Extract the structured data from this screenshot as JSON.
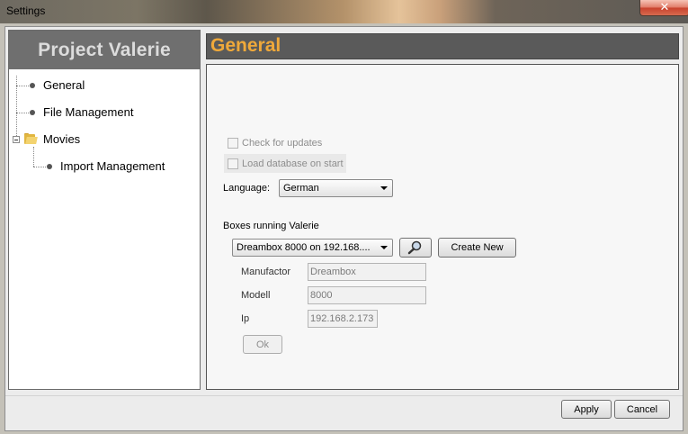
{
  "window": {
    "title": "Settings",
    "close_label": "✕"
  },
  "sidebar": {
    "header": "Project Valerie",
    "items": [
      {
        "label": "General"
      },
      {
        "label": "File Management"
      },
      {
        "label": "Movies",
        "icon": "folder-icon"
      },
      {
        "label": "Import Management"
      }
    ]
  },
  "general": {
    "header": "General",
    "check_updates_label": "Check for updates",
    "load_db_label": "Load database on start",
    "language_label": "Language:",
    "language_value": "German",
    "boxes_label": "Boxes running Valerie",
    "box_selected": "Dreambox 8000 on 192.168....",
    "search_icon": "magnifier-icon",
    "create_new_label": "Create New",
    "manufactor_label": "Manufactor",
    "manufactor_value": "Dreambox",
    "modell_label": "Modell",
    "modell_value": "8000",
    "ip_label": "Ip",
    "ip_value": "192.168.2.173",
    "ok_label": "Ok"
  },
  "footer": {
    "apply_label": "Apply",
    "cancel_label": "Cancel"
  },
  "colors": {
    "header_accent": "#f0a93a",
    "panel_header_bg": "#5a5a5a"
  }
}
